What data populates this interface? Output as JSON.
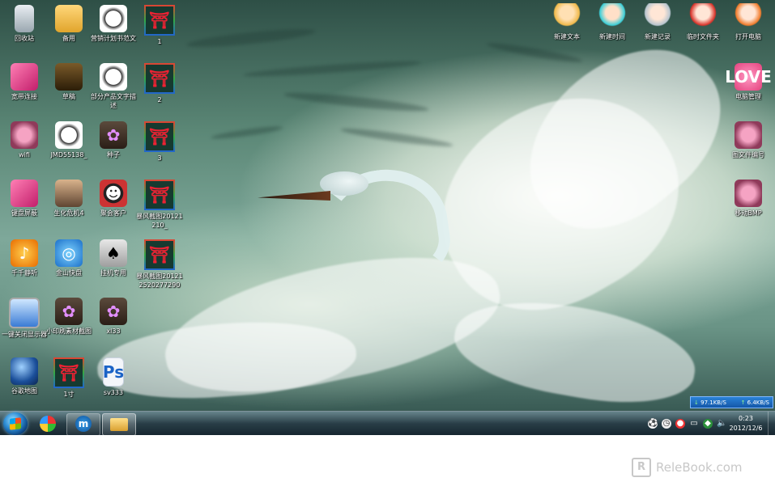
{
  "desktop": {
    "icons_left": [
      {
        "label": "回收站",
        "icon": "recycle-bin-icon"
      },
      {
        "label": "备用",
        "icon": "folder-icon"
      },
      {
        "label": "营销计划书范文",
        "icon": "dog-icon"
      },
      {
        "label": "1",
        "icon": "stamp-icon"
      },
      {
        "label": "宽带连接",
        "icon": "broadband-icon"
      },
      {
        "label": "草稿",
        "icon": "motorcycle-icon"
      },
      {
        "label": "部分产品文字描述",
        "icon": "dog-icon"
      },
      {
        "label": "2",
        "icon": "stamp-icon"
      },
      {
        "label": "wifi",
        "icon": "goggle-icon"
      },
      {
        "label": "JMD55138_",
        "icon": "dog-icon"
      },
      {
        "label": "种子",
        "icon": "lotus-folder-icon"
      },
      {
        "label": "3",
        "icon": "stamp-icon"
      },
      {
        "label": "键盘屏蔽",
        "icon": "pink-cube-icon"
      },
      {
        "label": "生化危机4",
        "icon": "game-face-icon"
      },
      {
        "label": "聚会客户",
        "icon": "cow-icon"
      },
      {
        "label": "暴风截图20121210_",
        "icon": "stamp-icon"
      },
      {
        "label": "千千静听",
        "icon": "music-player-icon"
      },
      {
        "label": "金山快盘",
        "icon": "cloud-disk-icon"
      },
      {
        "label": "挂机专用",
        "icon": "cards-icon"
      },
      {
        "label": "暴风截图201212520277290",
        "icon": "stamp-icon"
      },
      {
        "label": "一键关闭显示器",
        "icon": "monitor-icon"
      },
      {
        "label": "小印刷素材截图",
        "icon": "lotus-folder-icon"
      },
      {
        "label": "xl33",
        "icon": "lotus-folder-icon"
      },
      {
        "label": "谷歌地图",
        "icon": "earth-icon"
      },
      {
        "label": "1寸",
        "icon": "stamp-icon"
      },
      {
        "label": "sv333",
        "icon": "photoshop-file-icon"
      }
    ],
    "icons_right": [
      {
        "label": "新建文本",
        "icon": "girl-avatar-icon"
      },
      {
        "label": "新建时间",
        "icon": "girl-avatar-icon"
      },
      {
        "label": "新建记录",
        "icon": "girl-avatar-icon"
      },
      {
        "label": "临时文件夹",
        "icon": "girl-avatar-icon"
      },
      {
        "label": "打开电脑",
        "icon": "girl-avatar-icon"
      },
      {
        "label": "电脑管理",
        "icon": "love-heart-icon"
      },
      {
        "label": "图文件编号",
        "icon": "goggle-icon"
      },
      {
        "label": "移动BMP",
        "icon": "goggle-icon"
      }
    ]
  },
  "network_widget": {
    "download": "97.1KB/S",
    "upload": "6.4KB/S"
  },
  "taskbar": {
    "pinned": [
      "pinwheel-app-icon",
      "maxthon-browser-icon",
      "file-explorer-icon"
    ],
    "maxthon_glyph": "m",
    "clock_time": "0:23",
    "clock_date": "2012/12/6"
  },
  "watermark": {
    "text": "ReleBook.com",
    "logo": "R"
  }
}
